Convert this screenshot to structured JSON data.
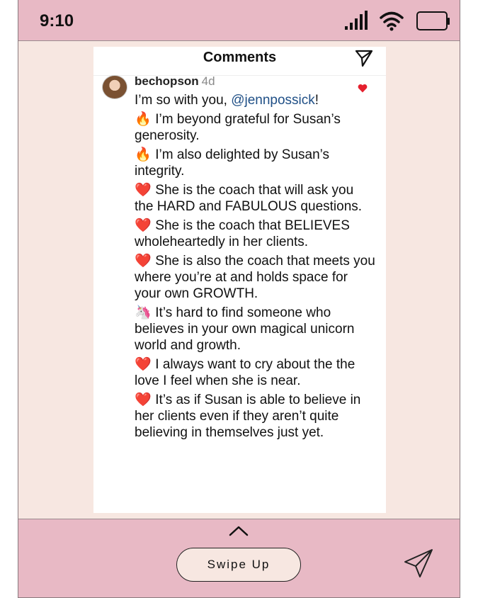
{
  "status_bar": {
    "time": "9:10"
  },
  "comments_panel": {
    "title": "Comments",
    "comment": {
      "username": "bechopson",
      "age": "4d",
      "intro_text": "I’m so with you, ",
      "mention": "@jennpossick",
      "intro_end": "!",
      "paragraphs": [
        {
          "emoji": "🔥",
          "text": " I’m beyond grateful for Susan’s generosity."
        },
        {
          "emoji": "🔥",
          "text": " I’m also delighted by Susan’s integrity."
        },
        {
          "emoji": "❤️",
          "text": " She is the coach that will ask you the HARD and FABULOUS questions."
        },
        {
          "emoji": "❤️",
          "text": " She is the coach that BELIEVES wholeheartedly in her clients."
        },
        {
          "emoji": "❤️",
          "text": " She is also the coach that meets you where you’re at and holds space for your own GROWTH."
        },
        {
          "emoji": "🦄",
          "text": " It’s hard to find someone who believes in your own magical unicorn world and growth."
        },
        {
          "emoji": "❤️",
          "text": " I always want to cry about the the love I feel when she is near."
        },
        {
          "emoji": "❤️",
          "text": " It’s as if Susan is able to believe in her clients even if they aren’t quite believing in themselves just yet."
        }
      ]
    }
  },
  "bottom_bar": {
    "swipe_label": "Swipe Up"
  },
  "icons": {
    "signal": "signal-icon",
    "wifi": "wifi-icon",
    "battery": "battery-icon",
    "send": "paper-plane-icon",
    "chevron": "chevron-up-icon",
    "heart": "heart-icon"
  },
  "colors": {
    "status_bar_bg": "#e8b9c5",
    "background": "#f7e7e1",
    "mention": "#1f4f86",
    "like_heart": "#e5202e"
  }
}
